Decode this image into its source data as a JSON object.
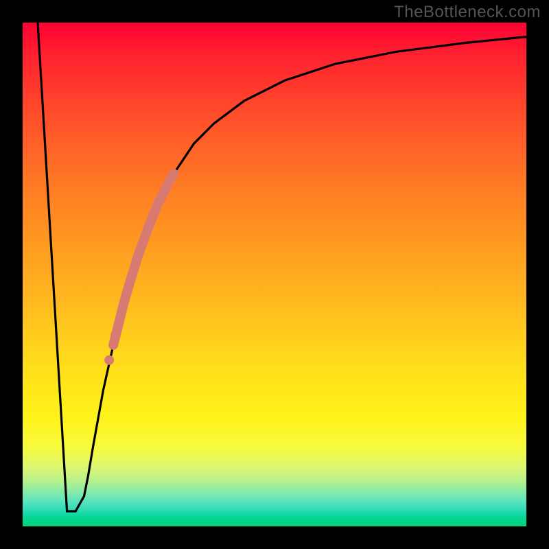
{
  "watermark": "TheBottleneck.com",
  "chart_data": {
    "type": "line",
    "title": "",
    "xlabel": "",
    "ylabel": "",
    "xlim": [
      0,
      100
    ],
    "ylim": [
      0,
      100
    ],
    "grid": false,
    "series": [
      {
        "name": "bottleneck-curve",
        "x": [
          3.0,
          8.8,
          10.5,
          12.2,
          13.0,
          14.0,
          16.0,
          18.0,
          20.0,
          22.0,
          24.0,
          26.0,
          28.0,
          30.0,
          34.0,
          38.0,
          44.0,
          52.0,
          62.0,
          74.0,
          88.0,
          100.0
        ],
        "values": [
          100,
          3.0,
          3.0,
          6.0,
          10.0,
          16.0,
          27.0,
          36.0,
          44.0,
          51.0,
          57.0,
          62.0,
          66.5,
          70.0,
          76.0,
          80.0,
          84.5,
          88.5,
          91.8,
          94.2,
          96.0,
          97.2
        ]
      }
    ],
    "highlight_segment": {
      "name": "highlight-band",
      "x": [
        18.0,
        19.0,
        20.0,
        21.0,
        23.0,
        25.0,
        27.0,
        29.0,
        30.0
      ],
      "values": [
        36.0,
        40.0,
        44.0,
        47.5,
        54.0,
        59.5,
        64.4,
        68.3,
        70.0
      ]
    },
    "highlight_dots": {
      "name": "highlight-dots",
      "points": [
        {
          "x": 17.2,
          "y": 33.0
        },
        {
          "x": 18.4,
          "y": 38.0
        },
        {
          "x": 19.0,
          "y": 40.0
        }
      ]
    },
    "background_gradient_stops": [
      {
        "pos": 0,
        "color": "#ff0033"
      },
      {
        "pos": 50,
        "color": "#ffa020"
      },
      {
        "pos": 80,
        "color": "#fff21a"
      },
      {
        "pos": 100,
        "color": "#00d47c"
      }
    ],
    "curve_color": "#000000",
    "highlight_color": "#d67a72"
  }
}
